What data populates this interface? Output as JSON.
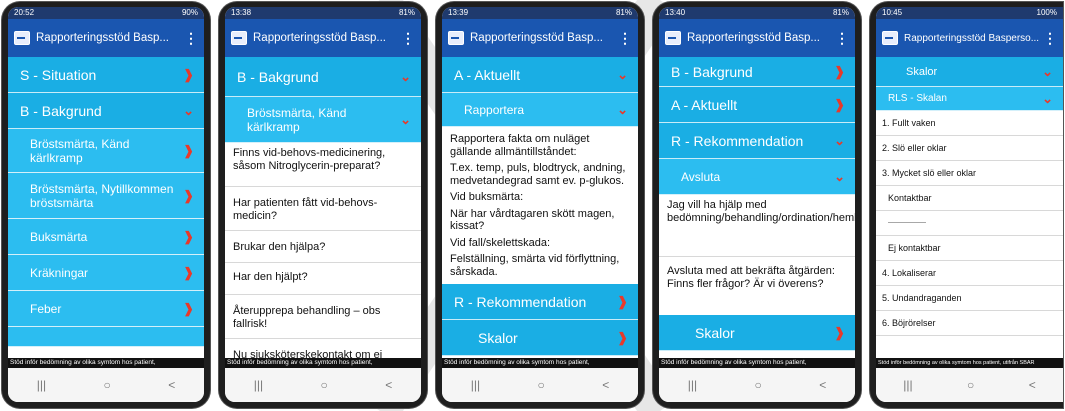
{
  "app_title": "Rapporteringsstöd Basp...",
  "app_title_p5": "Rapporteringsstöd Basperso...",
  "footer_text": "Stöd inför bedömning av olika symtom hos patient,",
  "footer_text_p5": "Stöd inför bedömning av olika symtom hos patient, utifrån SBAR",
  "nav": {
    "recent": "|||",
    "home": "○",
    "back": "<"
  },
  "phones": [
    {
      "status": {
        "time": "20:52",
        "right": "90%"
      },
      "sections": {
        "s_situation": "S - Situation",
        "b_bakgrund": "B - Bakgrund",
        "items": [
          "Bröstsmärta, Känd kärlkramp",
          "Bröstsmärta, Nytillkommen bröstsmärta",
          "Buksmärta",
          "Kräkningar",
          "Feber"
        ]
      }
    },
    {
      "status": {
        "time": "13:38",
        "right": "81%"
      },
      "b_bakgrund": "B - Bakgrund",
      "sub": "Bröstsmärta, Känd kärlkramp",
      "questions": [
        "Finns vid-behovs-medicinering, såsom Nitroglycerin-preparat?",
        "Har patienten fått vid-behovs-medicin?",
        "Brukar den hjälpa?",
        "Har den hjälpt?",
        "Återupprepa behandling – obs fallrisk!",
        "Nu sjuksköterskekontakt om ej"
      ]
    },
    {
      "status": {
        "time": "13:39",
        "right": "81%"
      },
      "a_aktuellt": "A - Aktuellt",
      "sub": "Rapportera",
      "lines": [
        "Rapportera fakta om nuläget gällande allmäntillståndet:",
        "T.ex. temp, puls, blodtryck, andning, medvetandegrad samt ev. p-glukos.",
        "Vid buksmärta:",
        "När har vårdtagaren skött magen, kissat?",
        "Vid fall/skelettskada:",
        "Felställning, smärta vid förflyttning, sårskada."
      ],
      "r_rek": "R - Rekommendation",
      "skalor": "Skalor"
    },
    {
      "status": {
        "time": "13:40",
        "right": "81%"
      },
      "b_bakgrund": "B - Bakgrund",
      "a_aktuellt": "A - Aktuellt",
      "r_rek": "R - Rekommendation",
      "sub": "Avsluta",
      "lines": [
        "Jag vill ha hjälp med bedömning/behandling/ordination/hembesök.",
        "Avsluta med att bekräfta åtgärden: Finns fler frågor? Är vi överens?"
      ],
      "skalor": "Skalor"
    },
    {
      "status": {
        "time": "10:45",
        "right": "100%"
      },
      "skalor": "Skalor",
      "sub": "RLS - Skalan",
      "rows": [
        "1. Fullt vaken",
        "2. Slö eller oklar",
        "3. Mycket slö eller oklar",
        "Kontaktbar",
        "-------------------",
        "Ej kontaktbar",
        "4. Lokaliserar",
        "5. Undandraganden",
        "6. Böjrörelser"
      ]
    }
  ]
}
